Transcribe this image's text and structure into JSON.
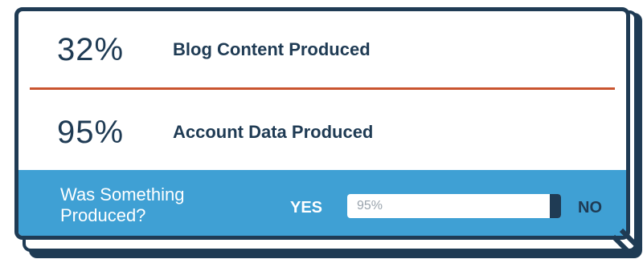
{
  "stats": [
    {
      "percent": "32%",
      "label": "Blog Content Produced"
    },
    {
      "percent": "95%",
      "label": "Account Data Produced"
    }
  ],
  "question": {
    "text": "Was Something Produced?",
    "yes_label": "YES",
    "no_label": "NO",
    "value_text": "95%",
    "fill_fraction": 0.95
  },
  "colors": {
    "navy": "#1f3b54",
    "accent_rule": "#c9542f",
    "blue_band": "#3fa0d4"
  }
}
